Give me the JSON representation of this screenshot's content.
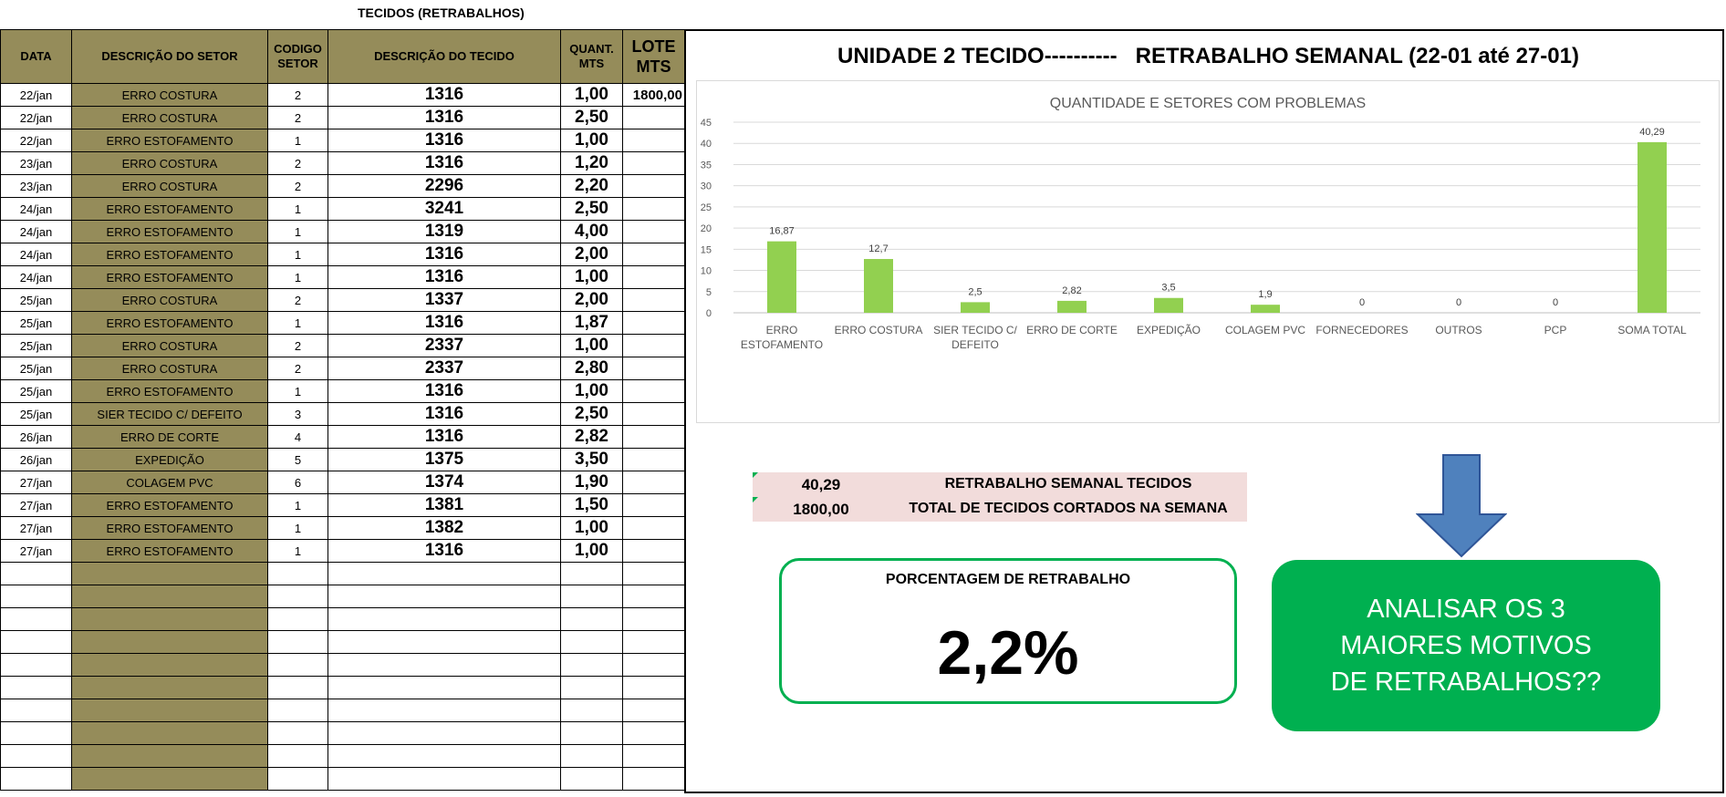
{
  "sheet": {
    "title": "TECIDOS (RETRABALHOS)"
  },
  "table": {
    "headers": {
      "date": "DATA",
      "sector": "DESCRIÇÃO DO SETOR",
      "code_1": "CODIGO",
      "code_2": "SETOR",
      "fabric": "DESCRIÇÃO DO TECIDO",
      "qty_1": "QUANT.",
      "qty_2": "MTS",
      "lote_1": "LOTE",
      "lote_2": "MTS"
    },
    "rows": [
      {
        "date": "22/jan",
        "sector": "ERRO COSTURA",
        "code": "2",
        "fabric": "1316",
        "qty": "1,00",
        "lote": "1800,00"
      },
      {
        "date": "22/jan",
        "sector": "ERRO COSTURA",
        "code": "2",
        "fabric": "1316",
        "qty": "2,50",
        "lote": ""
      },
      {
        "date": "22/jan",
        "sector": "ERRO ESTOFAMENTO",
        "code": "1",
        "fabric": "1316",
        "qty": "1,00",
        "lote": ""
      },
      {
        "date": "23/jan",
        "sector": "ERRO COSTURA",
        "code": "2",
        "fabric": "1316",
        "qty": "1,20",
        "lote": ""
      },
      {
        "date": "23/jan",
        "sector": "ERRO COSTURA",
        "code": "2",
        "fabric": "2296",
        "qty": "2,20",
        "lote": ""
      },
      {
        "date": "24/jan",
        "sector": "ERRO ESTOFAMENTO",
        "code": "1",
        "fabric": "3241",
        "qty": "2,50",
        "lote": ""
      },
      {
        "date": "24/jan",
        "sector": "ERRO ESTOFAMENTO",
        "code": "1",
        "fabric": "1319",
        "qty": "4,00",
        "lote": ""
      },
      {
        "date": "24/jan",
        "sector": "ERRO ESTOFAMENTO",
        "code": "1",
        "fabric": "1316",
        "qty": "2,00",
        "lote": ""
      },
      {
        "date": "24/jan",
        "sector": "ERRO ESTOFAMENTO",
        "code": "1",
        "fabric": "1316",
        "qty": "1,00",
        "lote": ""
      },
      {
        "date": "25/jan",
        "sector": "ERRO COSTURA",
        "code": "2",
        "fabric": "1337",
        "qty": "2,00",
        "lote": ""
      },
      {
        "date": "25/jan",
        "sector": "ERRO ESTOFAMENTO",
        "code": "1",
        "fabric": "1316",
        "qty": "1,87",
        "lote": ""
      },
      {
        "date": "25/jan",
        "sector": "ERRO COSTURA",
        "code": "2",
        "fabric": "2337",
        "qty": "1,00",
        "lote": ""
      },
      {
        "date": "25/jan",
        "sector": "ERRO COSTURA",
        "code": "2",
        "fabric": "2337",
        "qty": "2,80",
        "lote": ""
      },
      {
        "date": "25/jan",
        "sector": "ERRO ESTOFAMENTO",
        "code": "1",
        "fabric": "1316",
        "qty": "1,00",
        "lote": ""
      },
      {
        "date": "25/jan",
        "sector": "SIER TECIDO C/ DEFEITO",
        "code": "3",
        "fabric": "1316",
        "qty": "2,50",
        "lote": ""
      },
      {
        "date": "26/jan",
        "sector": "ERRO DE CORTE",
        "code": "4",
        "fabric": "1316",
        "qty": "2,82",
        "lote": ""
      },
      {
        "date": "26/jan",
        "sector": "EXPEDIÇÃO",
        "code": "5",
        "fabric": "1375",
        "qty": "3,50",
        "lote": ""
      },
      {
        "date": "27/jan",
        "sector": "COLAGEM PVC",
        "code": "6",
        "fabric": "1374",
        "qty": "1,90",
        "lote": ""
      },
      {
        "date": "27/jan",
        "sector": "ERRO ESTOFAMENTO",
        "code": "1",
        "fabric": "1381",
        "qty": "1,50",
        "lote": ""
      },
      {
        "date": "27/jan",
        "sector": "ERRO ESTOFAMENTO",
        "code": "1",
        "fabric": "1382",
        "qty": "1,00",
        "lote": ""
      },
      {
        "date": "27/jan",
        "sector": "ERRO ESTOFAMENTO",
        "code": "1",
        "fabric": "1316",
        "qty": "1,00",
        "lote": ""
      }
    ],
    "empty_row_count": 10
  },
  "dashboard": {
    "title": "UNIDADE 2 TECIDO----------   RETRABALHO SEMANAL (22-01 até 27-01)",
    "summary": {
      "weekly_value": "40,29",
      "weekly_label": "RETRABALHO SEMANAL TECIDOS",
      "total_value": "1800,00",
      "total_label": "TOTAL DE TECIDOS CORTADOS NA SEMANA"
    },
    "percent_label": "PORCENTAGEM DE RETRABALHO",
    "percent_value": "2,2%",
    "callout": "ANALISAR OS 3 MAIORES MOTIVOS DE RETRABALHOS??"
  },
  "colors": {
    "header_fill": "#958c5a",
    "bar": "#92d050",
    "accent_green": "#00b050",
    "arrow": "#4f81bd",
    "summary_fill": "#f2dcdb"
  },
  "chart_data": {
    "type": "bar",
    "title": "QUANTIDADE E SETORES COM PROBLEMAS",
    "categories": [
      [
        "ERRO",
        "ESTOFAMENTO"
      ],
      [
        "ERRO COSTURA"
      ],
      [
        "SIER TECIDO C/",
        "DEFEITO"
      ],
      [
        "ERRO DE CORTE"
      ],
      [
        "EXPEDIÇÃO"
      ],
      [
        "COLAGEM PVC"
      ],
      [
        "FORNECEDORES"
      ],
      [
        "OUTROS"
      ],
      [
        "PCP"
      ],
      [
        "SOMA TOTAL"
      ]
    ],
    "values": [
      16.87,
      12.7,
      2.5,
      2.82,
      3.5,
      1.9,
      0,
      0,
      0,
      40.29
    ],
    "data_labels": [
      "16,87",
      "12,7",
      "2,5",
      "2,82",
      "3,5",
      "1,9",
      "0",
      "0",
      "0",
      "40,29"
    ],
    "ylim": [
      0,
      45
    ],
    "yticks": [
      0,
      5,
      10,
      15,
      20,
      25,
      30,
      35,
      40,
      45
    ],
    "grid": true,
    "xlabel": "",
    "ylabel": ""
  }
}
